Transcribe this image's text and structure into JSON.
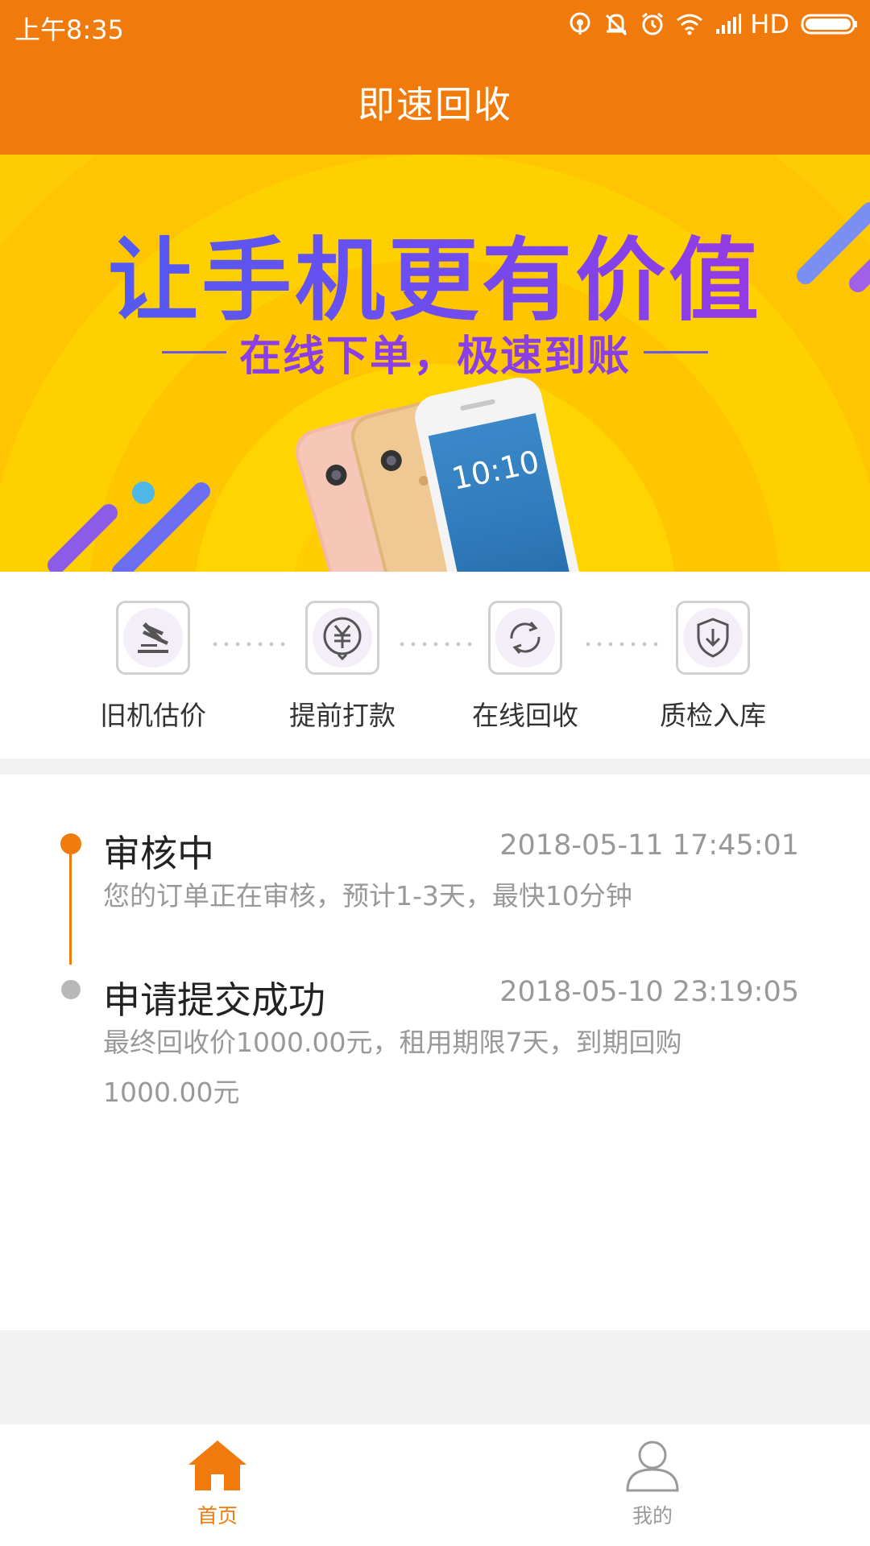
{
  "status_bar": {
    "time": "上午8:35",
    "network": "HD",
    "icons": [
      "hotspot-icon",
      "mute-icon",
      "alarm-icon",
      "wifi-icon",
      "signal-icon",
      "battery-icon"
    ]
  },
  "app_bar": {
    "title": "即速回收"
  },
  "banner": {
    "headline": "让手机更有价值",
    "subheadline": "在线下单，极速到账"
  },
  "steps": [
    {
      "label": "旧机估价",
      "icon": "gavel-icon"
    },
    {
      "label": "提前打款",
      "icon": "yuan-coin-icon"
    },
    {
      "label": "在线回收",
      "icon": "recycle-arrows-icon"
    },
    {
      "label": "质检入库",
      "icon": "shield-download-icon"
    }
  ],
  "timeline": [
    {
      "title": "审核中",
      "time": "2018-05-11 17:45:01",
      "description": "您的订单正在审核，预计1-3天，最快10分钟",
      "state": "active"
    },
    {
      "title": "申请提交成功",
      "time": "2018-05-10 23:19:05",
      "description": "最终回收价1000.00元，租用期限7天，到期回购1000.00元",
      "state": "done"
    }
  ],
  "tabbar": {
    "items": [
      {
        "label": "首页",
        "icon": "home-icon",
        "selected": true
      },
      {
        "label": "我的",
        "icon": "user-icon",
        "selected": false
      }
    ]
  },
  "colors": {
    "primary": "#f07b0c",
    "banner_bg": "#ffcb05",
    "text_muted": "#999999"
  }
}
